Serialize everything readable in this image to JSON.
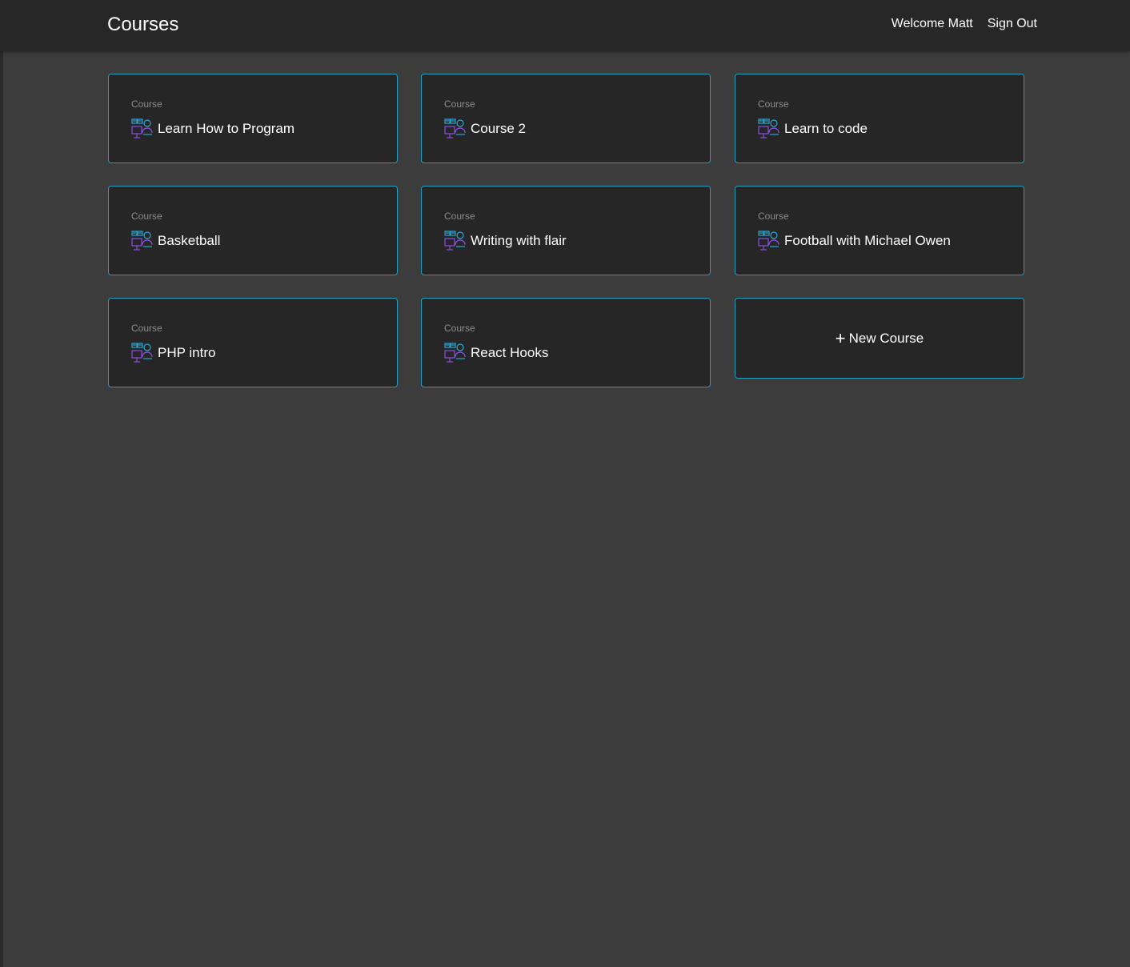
{
  "header": {
    "title": "Courses",
    "welcome": "Welcome Matt",
    "sign_out": "Sign Out"
  },
  "courses": [
    {
      "kind": "Course",
      "title": "Learn How to Program",
      "icon": "course-icon"
    },
    {
      "kind": "Course",
      "title": "Course 2",
      "icon": "course-icon"
    },
    {
      "kind": "Course",
      "title": "Learn to code",
      "icon": "course-icon"
    },
    {
      "kind": "Course",
      "title": "Basketball",
      "icon": "course-icon"
    },
    {
      "kind": "Course",
      "title": "Writing with flair",
      "icon": "course-icon"
    },
    {
      "kind": "Course",
      "title": "Football with Michael Owen",
      "icon": "course-icon"
    },
    {
      "kind": "Course",
      "title": "PHP intro",
      "icon": "course-icon"
    },
    {
      "kind": "Course",
      "title": "React Hooks",
      "icon": "course-icon"
    }
  ],
  "new_course": {
    "icon": "plus-icon",
    "label": "New Course"
  },
  "colors": {
    "background": "#3c3c3c",
    "header": "#272727",
    "card": "#262626",
    "card_border": "#1e9fbf",
    "icon_blue": "#2aa8d8",
    "icon_purple": "#8a4fe0"
  }
}
